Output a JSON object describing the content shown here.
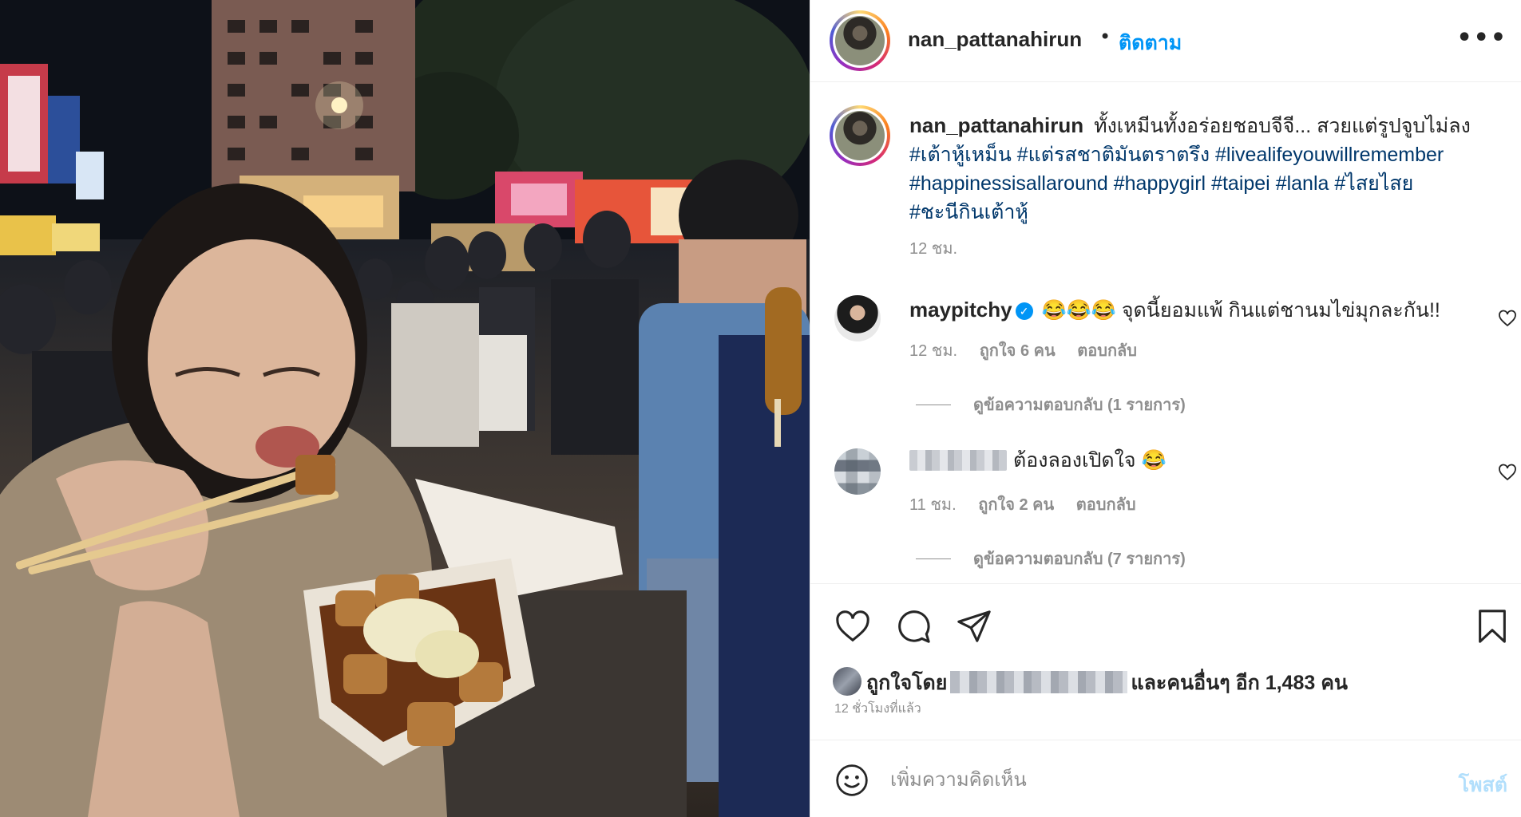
{
  "post": {
    "username": "nan_pattanahirun",
    "separator": "•",
    "follow_label": "ติดตาม",
    "more_label": "•••",
    "caption_text": "ทั้งเหมีนทั้งอร่อยชอบจีจี... สวยแต่รูปจูบไม่ลง",
    "hashtags": [
      "#เต้าหู้เหม็น",
      "#แต่รสชาติมันตราตรึง",
      "#livealifeyouwillremember",
      "#happinessisallaround",
      "#happygirl",
      "#taipei",
      "#lanla",
      "#ไสยไสย",
      "#ชะนีกินเต้าหู้"
    ],
    "caption_time": "12 ชม."
  },
  "comments": [
    {
      "username": "maypitchy",
      "verified": true,
      "text": "😂😂😂 จุดนี้ยอมแพ้ กินแต่ชานมไข่มุกละกัน!!",
      "time": "12 ชม.",
      "likes": "ถูกใจ 6 คน",
      "reply_label": "ตอบกลับ",
      "view_replies": "ดูข้อความตอบกลับ (1 รายการ)"
    },
    {
      "username": "",
      "verified": false,
      "text": "ต้องลองเปิดใจ 😂",
      "time": "11 ชม.",
      "likes": "ถูกใจ 2 คน",
      "reply_label": "ตอบกลับ",
      "view_replies": "ดูข้อความตอบกลับ (7 รายการ)"
    }
  ],
  "actions": {
    "icons": [
      "heart-icon",
      "comment-icon",
      "share-icon",
      "bookmark-icon"
    ],
    "likes_prefix": "ถูกใจโดย",
    "likes_suffix": "และคนอื่นๆ อีก 1,483 คน",
    "posted_time": "12 ชั่วโมงที่แล้ว"
  },
  "add_comment": {
    "placeholder": "เพิ่มความคิดเห็น",
    "post_label": "โพสต์"
  },
  "colors": {
    "accent": "#0095f6",
    "hashtag": "#00376b",
    "muted": "#8e8e8e",
    "post_disabled": "#b2dffc"
  }
}
